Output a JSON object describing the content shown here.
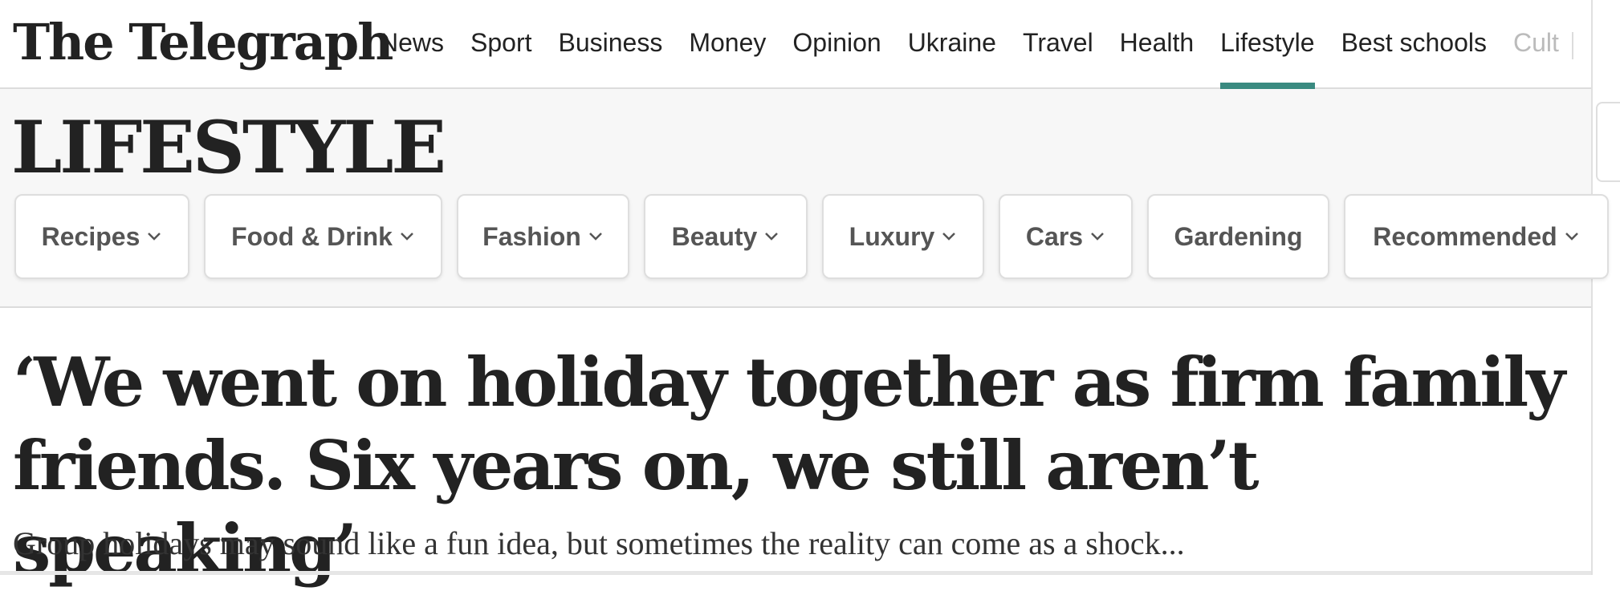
{
  "header": {
    "logo": "The Telegraph",
    "nav": [
      {
        "label": "News",
        "active": false
      },
      {
        "label": "Sport",
        "active": false
      },
      {
        "label": "Business",
        "active": false
      },
      {
        "label": "Money",
        "active": false
      },
      {
        "label": "Opinion",
        "active": false
      },
      {
        "label": "Ukraine",
        "active": false
      },
      {
        "label": "Travel",
        "active": false
      },
      {
        "label": "Health",
        "active": false
      },
      {
        "label": "Lifestyle",
        "active": true
      },
      {
        "label": "Best schools",
        "active": false
      },
      {
        "label": "Cult",
        "active": false
      }
    ],
    "active_color": "#3a8a80"
  },
  "section": {
    "title": "LIFESTYLE",
    "pills": [
      {
        "label": "Recipes",
        "icon": "chevron-down-icon"
      },
      {
        "label": "Food & Drink",
        "icon": "chevron-down-icon"
      },
      {
        "label": "Fashion",
        "icon": "chevron-down-icon"
      },
      {
        "label": "Beauty",
        "icon": "chevron-down-icon"
      },
      {
        "label": "Luxury",
        "icon": "chevron-down-icon"
      },
      {
        "label": "Cars",
        "icon": "chevron-down-icon"
      },
      {
        "label": "Gardening",
        "icon": ""
      },
      {
        "label": "Recommended",
        "icon": "chevron-down-icon"
      }
    ]
  },
  "article": {
    "headline": "‘We went on holiday together as firm family friends. Six years on, we still aren’t speaking’",
    "standfirst": "Group holidays may sound like a fun idea, but sometimes the reality can come as a shock..."
  }
}
